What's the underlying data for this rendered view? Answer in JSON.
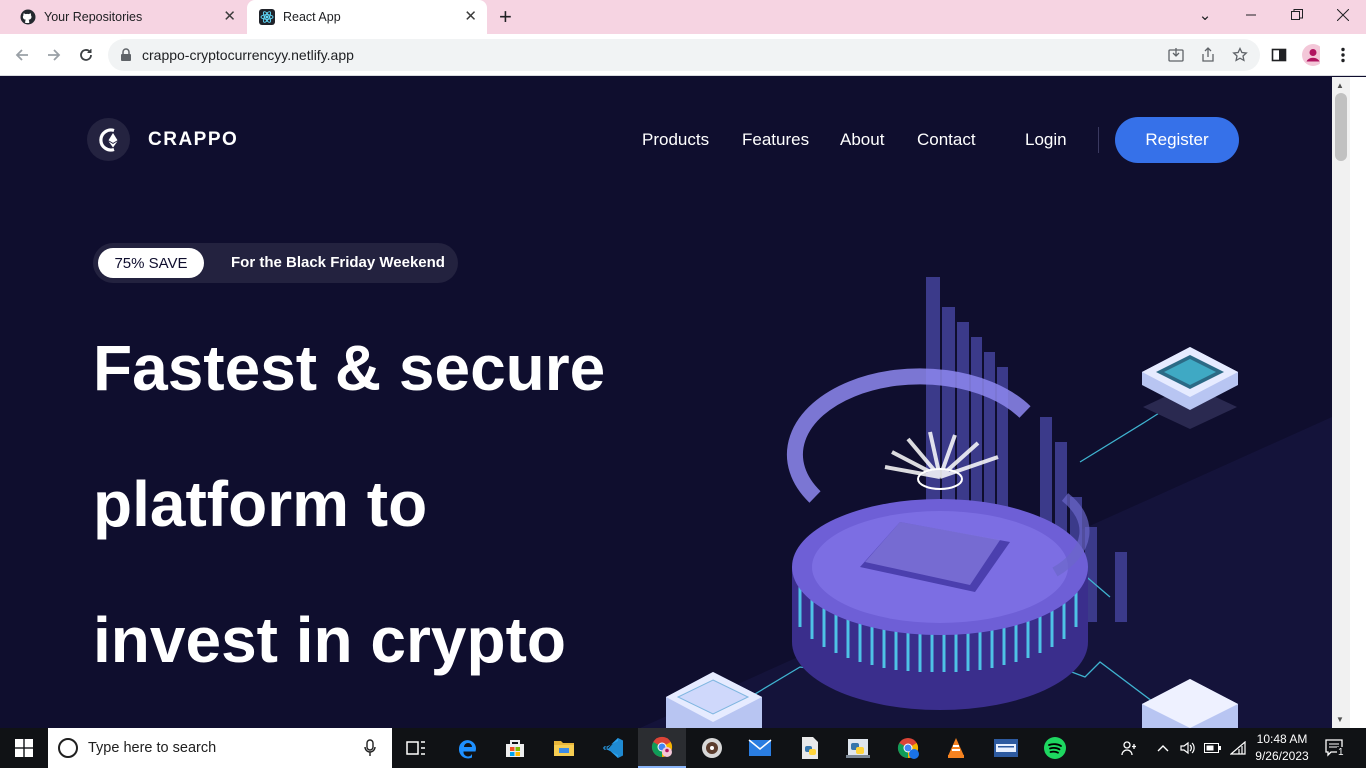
{
  "browser": {
    "tabs": [
      {
        "title": "Your Repositories",
        "icon": "github-icon"
      },
      {
        "title": "React App",
        "icon": "react-icon",
        "active": true
      }
    ],
    "new_tab_label": "+",
    "url": "crappo-cryptocurrencyy.netlify.app"
  },
  "site": {
    "logo_text": "CRAPPO",
    "nav": {
      "products": "Products",
      "features": "Features",
      "about": "About",
      "contact": "Contact",
      "login": "Login",
      "register": "Register"
    },
    "promo": {
      "badge": "75% SAVE",
      "text": "For the Black Friday Weekend"
    },
    "headline": {
      "line1": "Fastest & secure",
      "line2": "platform to",
      "line3": "invest in crypto"
    },
    "colors": {
      "background": "#0f0e2e",
      "accent": "#3671e9",
      "promo_bg": "#23223f"
    }
  },
  "taskbar": {
    "search_placeholder": "Type here to search",
    "time": "10:48 AM",
    "date": "9/26/2023",
    "notification_count": "1"
  }
}
